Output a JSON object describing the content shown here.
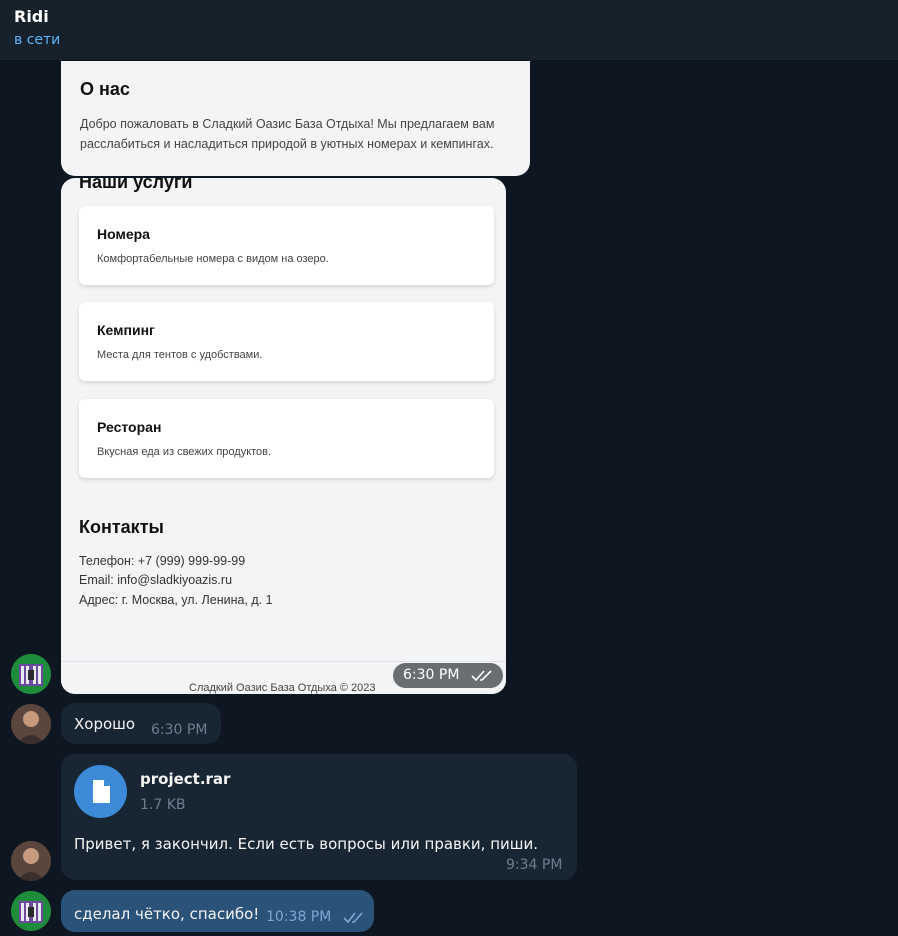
{
  "header": {
    "title": "Ridi",
    "status": "в сети"
  },
  "screenshot": {
    "about_title": "О нас",
    "about_text": "Добро пожаловать в Сладкий Оазис База Отдыха! Мы предлагаем вам расслабиться и насладиться природой в уютных номерах и кемпингах.",
    "services_title": "Наши услуги",
    "services": [
      {
        "name": "Номера",
        "desc": "Комфортабельные номера с видом на озеро."
      },
      {
        "name": "Кемпинг",
        "desc": "Места для тентов с удобствами."
      },
      {
        "name": "Ресторан",
        "desc": "Вкусная еда из свежих продуктов."
      }
    ],
    "contacts_title": "Контакты",
    "phone": "Телефон: +7 (999) 999-99-99",
    "email": "Email: info@sladkiyoazis.ru",
    "address": "Адрес: г. Москва, ул. Ленина, д. 1",
    "footer": "Сладкий Оазис База Отдыха © 2023",
    "time": "6:30 PM"
  },
  "messages": [
    {
      "text": "Хорошо",
      "time": "6:30 PM"
    },
    {
      "file_name": "project.rar",
      "file_size": "1.7 KB",
      "text": "Привет, я закончил. Если есть вопросы или правки, пиши.",
      "time": "9:34 PM"
    },
    {
      "text": "сделал чётко, спасибо!",
      "time": "10:38 PM"
    }
  ],
  "colors": {
    "background": "#0e1621",
    "incoming": "#182533",
    "outgoing": "#2b5278",
    "accent": "#5eb5f7"
  }
}
